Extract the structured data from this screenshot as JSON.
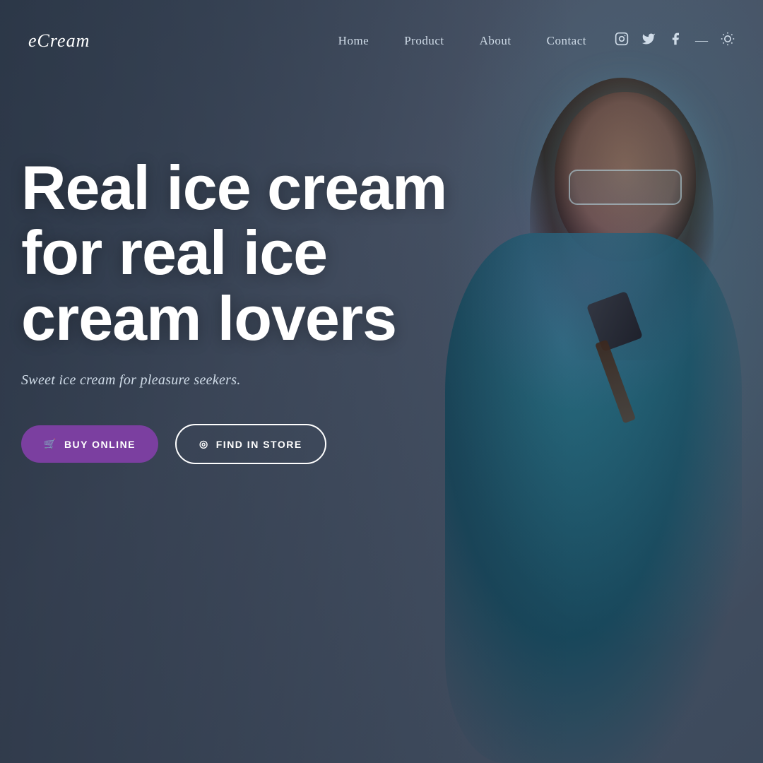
{
  "brand": {
    "logo": "eCream"
  },
  "navbar": {
    "links": [
      {
        "id": "home",
        "label": "Home"
      },
      {
        "id": "product",
        "label": "Product"
      },
      {
        "id": "about",
        "label": "About"
      },
      {
        "id": "contact",
        "label": "Contact"
      }
    ],
    "icons": [
      {
        "id": "instagram",
        "symbol": "⊙",
        "unicode": "𝓘"
      },
      {
        "id": "twitter",
        "symbol": "𝕏"
      },
      {
        "id": "facebook",
        "symbol": "𝒻"
      },
      {
        "id": "theme",
        "symbol": "✦"
      }
    ]
  },
  "hero": {
    "title_line1": "Real ice cream for real ice",
    "title_line2": "cream lovers",
    "subtitle": "Sweet ice cream for pleasure seekers.",
    "buttons": [
      {
        "id": "buy-online",
        "label": "BUY ONLINE",
        "icon": "🛒",
        "type": "primary"
      },
      {
        "id": "find-in-store",
        "label": "FIND IN STORE",
        "icon": "📍",
        "type": "secondary"
      }
    ]
  },
  "colors": {
    "background": "#3d4a5c",
    "text_primary": "#ffffff",
    "text_secondary": "#d0dce8",
    "button_primary_bg": "#7b3fa0",
    "nav_text": "#d0dce8"
  }
}
